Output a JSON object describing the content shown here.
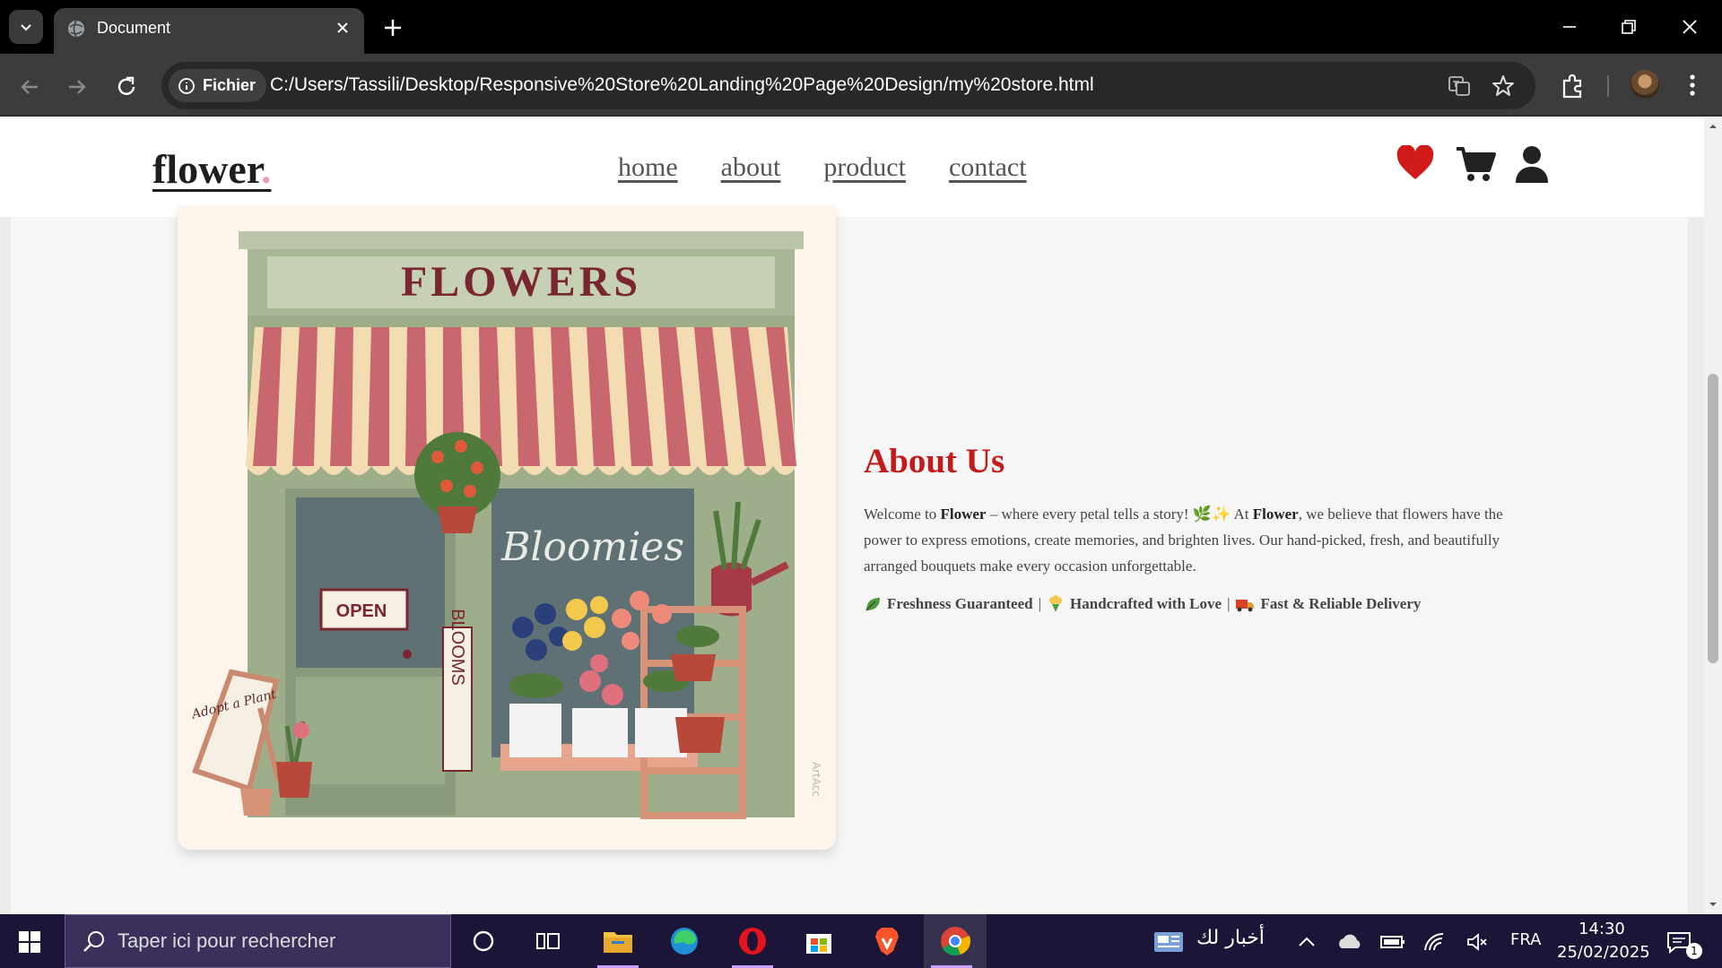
{
  "browser": {
    "tab_title": "Document",
    "site_chip_label": "Fichier",
    "url": "C:/Users/Tassili/Desktop/Responsive%20Store%20Landing%20Page%20Design/my%20store.html"
  },
  "site": {
    "logo": "flower",
    "logo_dot": ".",
    "nav": [
      "home",
      "about",
      "product",
      "contact"
    ],
    "icons": [
      "heart-icon",
      "cart-icon",
      "user-icon"
    ],
    "accent_color": "#c51a1a"
  },
  "about": {
    "title": "About Us",
    "para_1": "Welcome to ",
    "brand": "Flower",
    "para_2": " – where every petal tells a story! 🌿✨ At ",
    "para_3": ", we believe that flowers have the power to express emotions, create memories, and brighten lives. Our hand-picked, fresh, and beautifully arranged bouquets make every occasion unforgettable.",
    "features": [
      "Freshness Guaranteed",
      "Handcrafted with Love",
      "Fast & Reliable Delivery"
    ],
    "feature_separator": "|",
    "image_texts": {
      "sign": "FLOWERS",
      "window": "Bloomies",
      "open_sign": "OPEN",
      "vertical_sign": "BLOOMS",
      "board": "Adopt a Plant"
    }
  },
  "taskbar": {
    "search_placeholder": "Taper ici pour rechercher",
    "news": "أخبار لك",
    "language": "FRA",
    "time": "14:30",
    "date": "25/02/2025",
    "notification_count": "1"
  }
}
